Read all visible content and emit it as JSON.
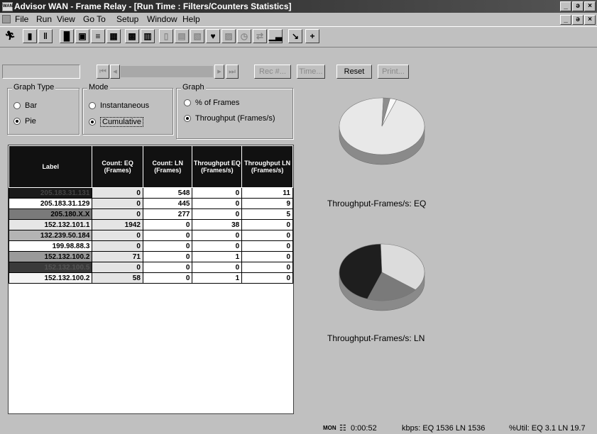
{
  "window": {
    "app_icon": "WAN",
    "title": "Advisor WAN - Frame Relay - [Run Time : Filters/Counters Statistics]",
    "controls": [
      "_",
      "ə",
      "×"
    ]
  },
  "menu": {
    "items": [
      "File",
      "Run",
      "View",
      "Go To",
      "Setup",
      "Window",
      "Help"
    ]
  },
  "nav": {
    "rec_label": "Rec #...",
    "time_label": "Time...",
    "reset_label": "Reset",
    "print_label": "Print..."
  },
  "graph_type": {
    "legend": "Graph Type",
    "options": [
      "Bar",
      "Pie"
    ],
    "selected": "Pie"
  },
  "mode": {
    "legend": "Mode",
    "options": [
      "Instantaneous",
      "Cumulative"
    ],
    "selected": "Cumulative"
  },
  "graph": {
    "legend": "Graph",
    "options": [
      "% of Frames",
      "Throughput (Frames/s)"
    ],
    "selected": "Throughput (Frames/s)"
  },
  "table": {
    "headers": [
      "Label",
      "Count: EQ (Frames)",
      "Count: LN (Frames)",
      "Throughput EQ (Frames/s)",
      "Throughput LN (Frames/s)"
    ],
    "rows": [
      {
        "label": "205.183.31.131",
        "color": "#1a1a1a",
        "text_color": "#444",
        "eq": "0",
        "ln": "548",
        "teq": "0",
        "tln": "11"
      },
      {
        "label": "205.183.31.129",
        "color": "#ffffff",
        "text_color": "#000",
        "eq": "0",
        "ln": "445",
        "teq": "0",
        "tln": "9"
      },
      {
        "label": "205.180.X.X",
        "color": "#7a7a7a",
        "text_color": "#000",
        "eq": "0",
        "ln": "277",
        "teq": "0",
        "tln": "5"
      },
      {
        "label": "152.132.101.1",
        "color": "#e6e6e6",
        "text_color": "#000",
        "eq": "1942",
        "ln": "0",
        "teq": "38",
        "tln": "0"
      },
      {
        "label": "132.239.50.184",
        "color": "#b4b4b4",
        "text_color": "#000",
        "eq": "0",
        "ln": "0",
        "teq": "0",
        "tln": "0"
      },
      {
        "label": "199.98.88.3",
        "color": "#ffffff",
        "text_color": "#000",
        "eq": "0",
        "ln": "0",
        "teq": "0",
        "tln": "0"
      },
      {
        "label": "152.132.100.2",
        "color": "#9a9a9a",
        "text_color": "#000",
        "eq": "71",
        "ln": "0",
        "teq": "1",
        "tln": "0"
      },
      {
        "label": "152.132.100.5",
        "color": "#3a3a3a",
        "text_color": "#555",
        "eq": "0",
        "ln": "0",
        "teq": "0",
        "tln": "0"
      },
      {
        "label": "152.132.100.2",
        "color": "#f4f4f4",
        "text_color": "#000",
        "eq": "58",
        "ln": "0",
        "teq": "1",
        "tln": "0"
      }
    ]
  },
  "pies": [
    {
      "caption": "Throughput-Frames/s: EQ",
      "slices": [
        {
          "value": 38,
          "color": "#e8e8e8"
        },
        {
          "value": 1,
          "color": "#8e8e8e"
        },
        {
          "value": 1,
          "color": "#f8f8f8"
        }
      ]
    },
    {
      "caption": "Throughput-Frames/s: LN",
      "slices": [
        {
          "value": 11,
          "color": "#1e1e1e"
        },
        {
          "value": 9,
          "color": "#dcdcdc"
        },
        {
          "value": 5,
          "color": "#7a7a7a"
        }
      ]
    }
  ],
  "status": {
    "mon_label": "MON",
    "elapsed": "0:00:52",
    "kbps": "kbps: EQ 1536  LN 1536",
    "util": "%Util: EQ 3.1  LN 19.7"
  }
}
